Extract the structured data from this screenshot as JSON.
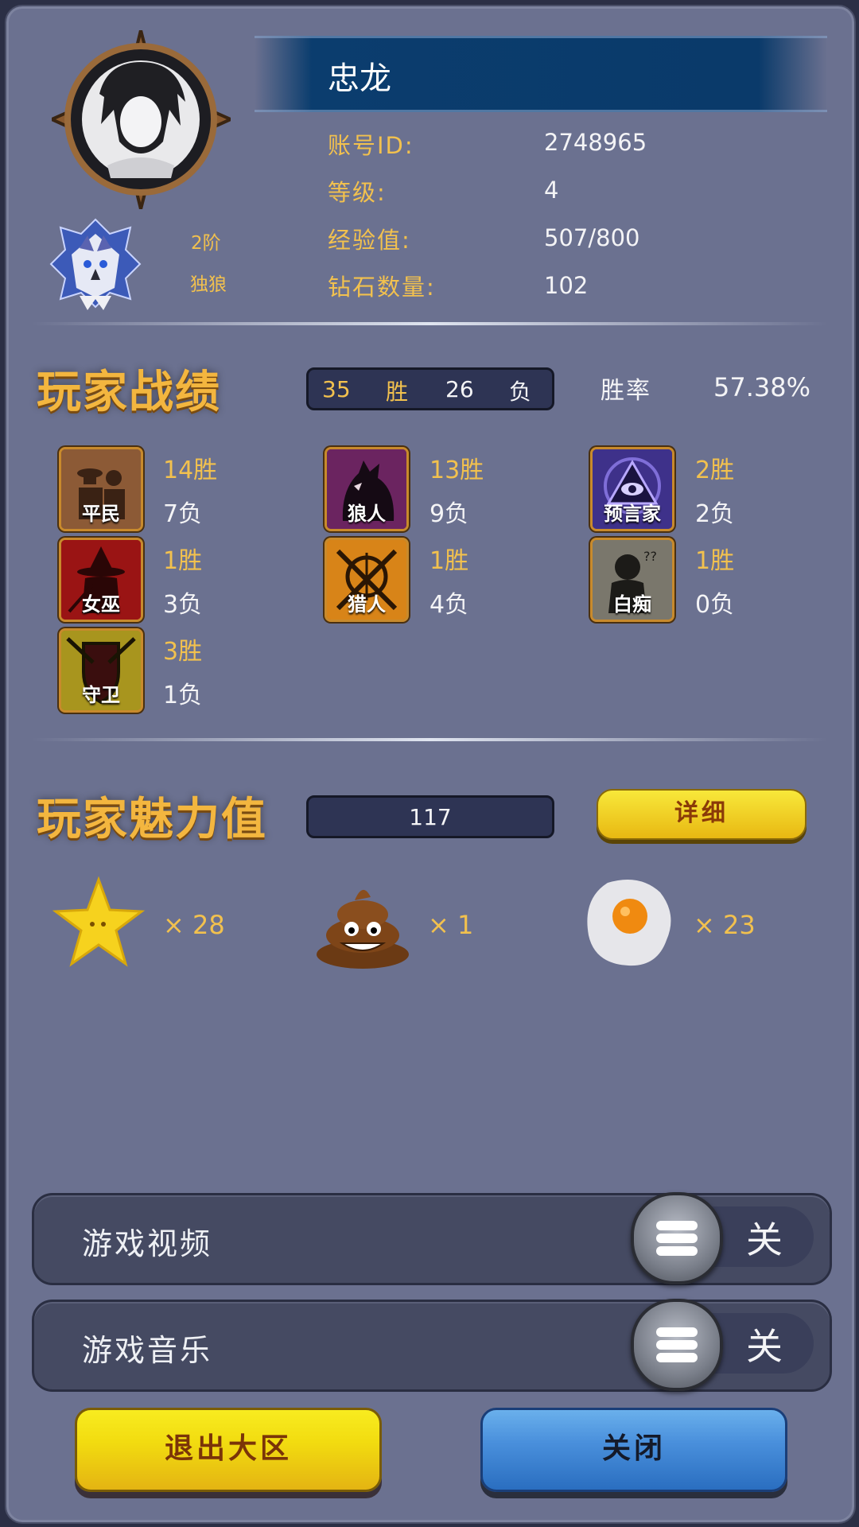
{
  "profile": {
    "name": "忠龙",
    "rank": {
      "tier": "2阶",
      "title": "独狼"
    },
    "fields": [
      {
        "label": "账号ID:",
        "value": "2748965"
      },
      {
        "label": "等级:",
        "value": "4"
      },
      {
        "label": "经验值:",
        "value": "507/800"
      },
      {
        "label": "钻石数量:",
        "value": "102"
      }
    ]
  },
  "record": {
    "title": "玩家战绩",
    "wins": "35",
    "wins_label": "胜",
    "losses": "26",
    "losses_label": "负",
    "rate_label": "胜率",
    "rate_value": "57.38%",
    "roles": [
      {
        "name": "平民",
        "wins": "14胜",
        "losses": "7负",
        "icon": "villager-icon"
      },
      {
        "name": "狼人",
        "wins": "13胜",
        "losses": "9负",
        "icon": "werewolf-icon"
      },
      {
        "name": "预言家",
        "wins": "2胜",
        "losses": "2负",
        "icon": "seer-eye-icon"
      },
      {
        "name": "女巫",
        "wins": "1胜",
        "losses": "3负",
        "icon": "witch-icon"
      },
      {
        "name": "猎人",
        "wins": "1胜",
        "losses": "4负",
        "icon": "hunter-crosshair-icon"
      },
      {
        "name": "白痴",
        "wins": "1胜",
        "losses": "0负",
        "icon": "idiot-icon"
      },
      {
        "name": "守卫",
        "wins": "3胜",
        "losses": "1负",
        "icon": "guard-shield-icon"
      }
    ]
  },
  "charm": {
    "title": "玩家魅力值",
    "value": "117",
    "detail_button": "详细",
    "gifts": [
      {
        "icon": "star-icon",
        "count": "× 28"
      },
      {
        "icon": "poop-icon",
        "count": "× 1"
      },
      {
        "icon": "fried-egg-icon",
        "count": "× 23"
      }
    ]
  },
  "settings": [
    {
      "label": "游戏视频",
      "state": "关"
    },
    {
      "label": "游戏音乐",
      "state": "关"
    }
  ],
  "buttons": {
    "exit": "退出大区",
    "close": "关闭"
  },
  "colors": {
    "panel": "#6b7190",
    "gold": "#f2c14e",
    "name_banner": "#0b3d6e",
    "yellow_button": "#f3cf1c",
    "blue_button": "#3c86d3"
  }
}
